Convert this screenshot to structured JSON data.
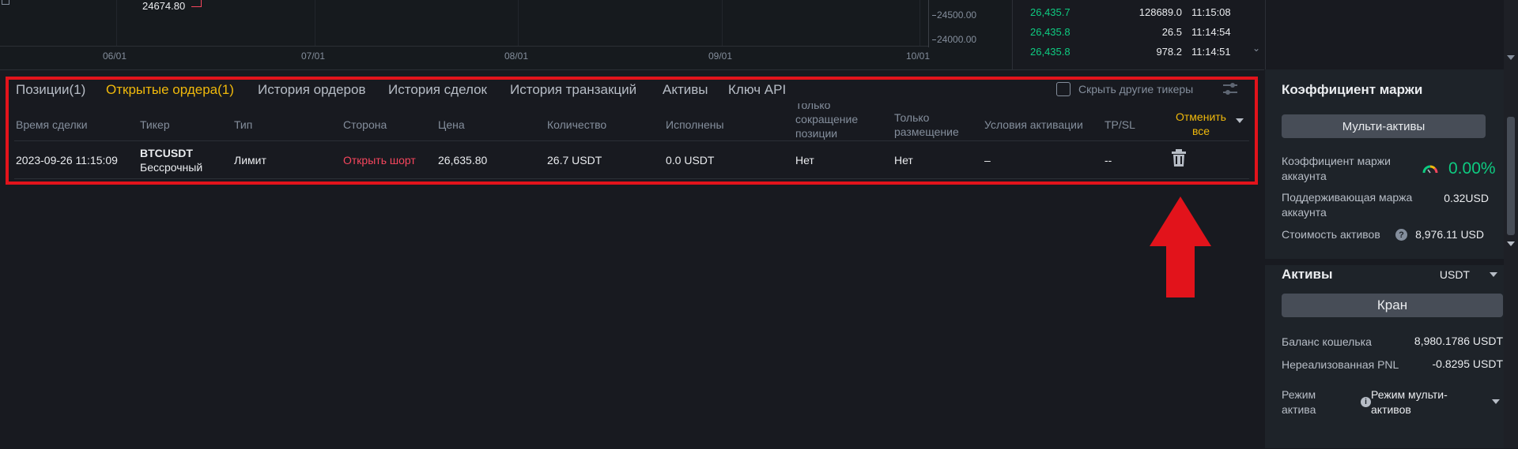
{
  "chart": {
    "price_label": "24674.80",
    "x_ticks": [
      "06/01",
      "07/01",
      "08/01",
      "09/01",
      "10/01"
    ],
    "y_ticks": [
      "24500.00",
      "24000.00"
    ]
  },
  "trades": [
    {
      "price": "26,435.7",
      "qty": "128689.0",
      "time": "11:15:08"
    },
    {
      "price": "26,435.8",
      "qty": "26.5",
      "time": "11:14:54"
    },
    {
      "price": "26,435.8",
      "qty": "978.2",
      "time": "11:14:51"
    }
  ],
  "tabs": [
    {
      "label": "Позиции(1)",
      "active": false
    },
    {
      "label": "Открытые ордера(1)",
      "active": true
    },
    {
      "label": "История ордеров",
      "active": false
    },
    {
      "label": "История сделок",
      "active": false
    },
    {
      "label": "История транзакций",
      "active": false
    },
    {
      "label": "Активы",
      "active": false
    },
    {
      "label": "Ключ API",
      "active": false
    }
  ],
  "hide_other_tickers": "Скрыть другие тикеры",
  "table": {
    "headers": {
      "time": "Время сделки",
      "ticker": "Тикер",
      "type": "Тип",
      "side": "Сторона",
      "price": "Цена",
      "quantity": "Количество",
      "filled": "Исполнены",
      "reduce_only_1": "Только",
      "reduce_only_2": "сокращение",
      "reduce_only_3": "позиции",
      "post_only_1": "Только",
      "post_only_2": "размещение",
      "trigger": "Условия активации",
      "tpsl": "TP/SL",
      "cancel_all_1": "Отменить",
      "cancel_all_2": "все"
    },
    "row": {
      "time": "2023-09-26 11:15:09",
      "ticker": "BTCUSDT",
      "contract": "Бессрочный",
      "type": "Лимит",
      "side": "Открыть шорт",
      "price": "26,635.80",
      "quantity": "26.7 USDT",
      "filled": "0.0 USDT",
      "reduce_only": "Нет",
      "post_only": "Нет",
      "trigger": "–",
      "tpsl": "--"
    }
  },
  "right_panel": {
    "margin_title": "Коэффициент маржи",
    "multi_assets_btn": "Мульти-активы",
    "account_margin_ratio_1": "Коэффициент маржи",
    "account_margin_ratio_2": "аккаунта",
    "account_margin_ratio_value": "0.00%",
    "maintenance_margin_1": "Поддерживающая маржа",
    "maintenance_margin_2": "аккаунта",
    "maintenance_margin_value": "0.32USD",
    "asset_value_label": "Стоимость активов",
    "asset_value": "8,976.11 USD",
    "assets_title": "Активы",
    "assets_currency": "USDT",
    "faucet_btn": "Кран",
    "wallet_balance_label": "Баланс кошелька",
    "wallet_balance_value": "8,980.1786 USDT",
    "unrealized_pnl_label": "Нереализованная PNL",
    "unrealized_pnl_value": "-0.8295 USDT",
    "mode_label_1": "Режим",
    "mode_label_2": "актива",
    "mode_value_1": "Режим мульти-",
    "mode_value_2": "активов"
  },
  "colors": {
    "accent": "#f0b90b",
    "buy": "#0ecb81",
    "sell": "#f6465d",
    "highlight": "#e2131b"
  }
}
